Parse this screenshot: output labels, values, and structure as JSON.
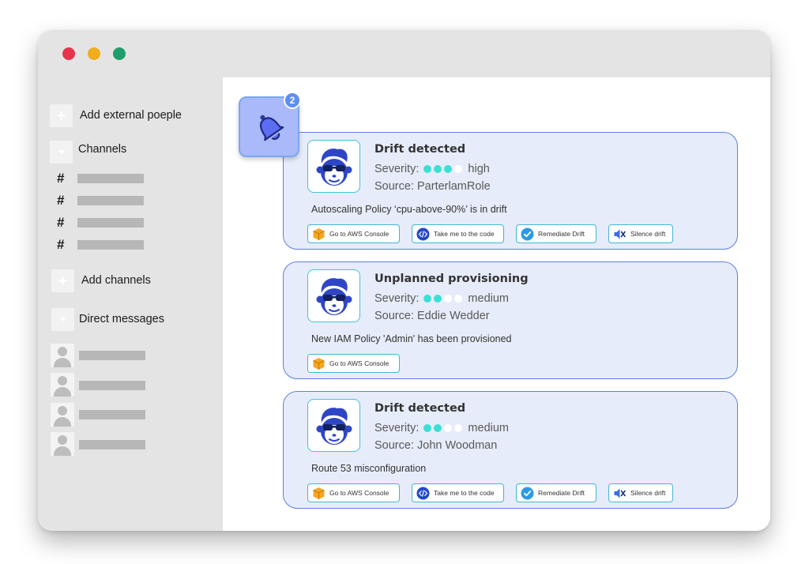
{
  "sidebar": {
    "add_people_label": "Add external poeple",
    "channels_label": "Channels",
    "channel_hash": "#",
    "add_channels_label": "Add channels",
    "direct_messages_label": "Direct messages"
  },
  "notification": {
    "badge_count": "2"
  },
  "cards": [
    {
      "title": "Drift detected",
      "severity_label": "Severity:",
      "severity_dots": 3,
      "severity_level": "high",
      "source": "Source: ParterlamRole",
      "description": "Autoscaling Policy ‘cpu-above-90%’  is in drift",
      "actions": [
        "Go to AWS Console",
        "Take me to the code",
        "Remediate Drift",
        "Silence drift"
      ]
    },
    {
      "title": "Unplanned provisioning",
      "severity_label": "Severity:",
      "severity_dots": 2,
      "severity_level": "medium",
      "source": "Source:  Eddie Wedder",
      "description": "New IAM Policy 'Admin' has been provisioned",
      "actions": [
        "Go to AWS Console"
      ]
    },
    {
      "title": "Drift detected",
      "severity_label": "Severity:",
      "severity_dots": 2,
      "severity_level": "medium",
      "source": "Source: John Woodman",
      "description": "Route 53 misconfiguration",
      "actions": [
        "Go to AWS Console",
        "Take me to the code",
        "Remediate Drift",
        "Silence drift"
      ]
    }
  ],
  "colors": {
    "accent": "#5e7fe8",
    "severity_on": "#3ae0d4",
    "card_bg": "#e6ecf9",
    "sidebar_bg": "#e4e4e4",
    "aws_orange": "#f5a623"
  }
}
